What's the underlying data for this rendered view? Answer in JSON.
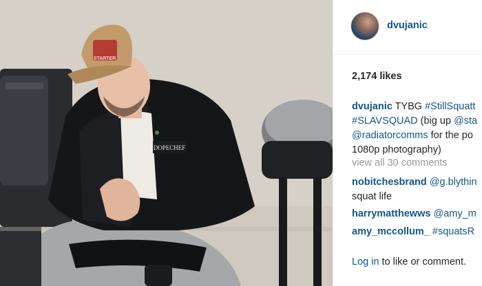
{
  "post": {
    "username": "dvujanic",
    "likes": "2,174 likes",
    "caption": {
      "author": "dvujanic",
      "line1_text": " TYBG ",
      "line1_tag": "#StillSquatt",
      "line2_tag": "#SLAVSQUAD",
      "line2_text": " (big up ",
      "line2_mention": "@sta",
      "line3_mention": "@radiatorcomms",
      "line3_text": " for the po",
      "line4_text": "1080p photography)"
    },
    "view_all": "view all 30 comments",
    "comments": [
      {
        "user": "nobitchesbrand",
        "text": "@g.blythin",
        "text2": "squat life"
      },
      {
        "user": "harrymatthewws",
        "text": "@amy_m"
      },
      {
        "user": "amy_mccollum_",
        "text": "#squatsR"
      }
    ],
    "footer": {
      "login": "Log in",
      "rest": " to like or comment."
    },
    "photo": {
      "cap_logo_text": "STARTER",
      "jacket_patch_text": "DOPECHEF"
    }
  }
}
